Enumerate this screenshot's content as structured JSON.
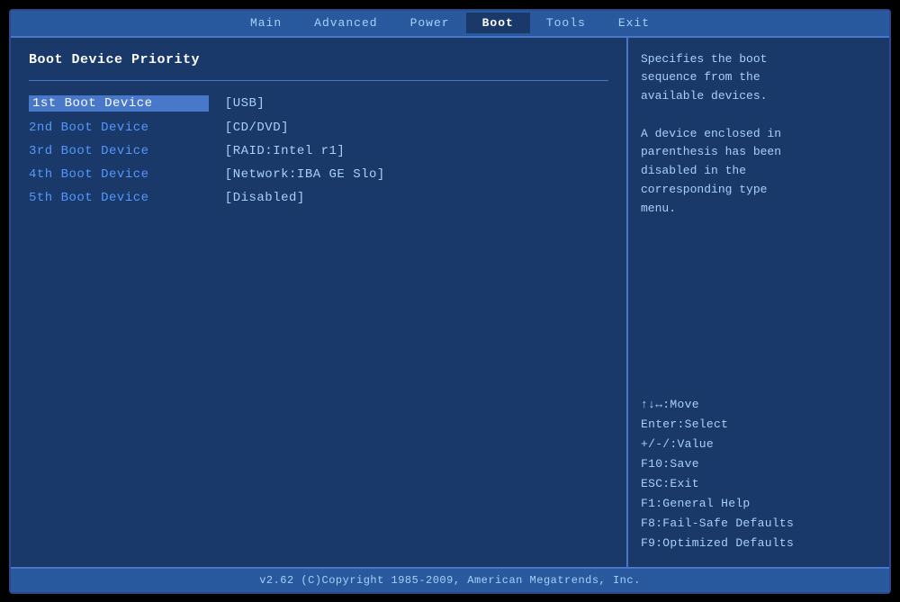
{
  "topBar": {
    "tabs": [
      {
        "label": "Main",
        "active": false
      },
      {
        "label": "Advanced",
        "active": false
      },
      {
        "label": "Power",
        "active": false
      },
      {
        "label": "Boot",
        "active": true
      },
      {
        "label": "Tools",
        "active": false
      },
      {
        "label": "Exit",
        "active": false
      }
    ]
  },
  "leftPanel": {
    "sectionTitle": "Boot Device Priority",
    "bootDevices": [
      {
        "label": "1st Boot Device",
        "value": "[USB]",
        "selected": true
      },
      {
        "label": "2nd Boot Device",
        "value": "[CD/DVD]",
        "selected": false
      },
      {
        "label": "3rd Boot Device",
        "value": "[RAID:Intel r1]",
        "selected": false
      },
      {
        "label": "4th Boot Device",
        "value": "[Network:IBA GE Slo]",
        "selected": false
      },
      {
        "label": "5th Boot Device",
        "value": "[Disabled]",
        "selected": false
      }
    ]
  },
  "rightPanel": {
    "helpText": "Specifies the boot sequence from the available devices.\n\nA device enclosed in parenthesis has been disabled in the corresponding type menu.",
    "keyHelp": [
      "↑↓↔:Move",
      "Enter:Select",
      "+/-/:Value",
      "F10:Save",
      "ESC:Exit",
      "F1:General Help",
      "F8:Fail-Safe Defaults",
      "F9:Optimized Defaults"
    ]
  },
  "bottomBar": {
    "text": "v2.62  (C)Copyright 1985-2009, American Megatrends, Inc."
  }
}
